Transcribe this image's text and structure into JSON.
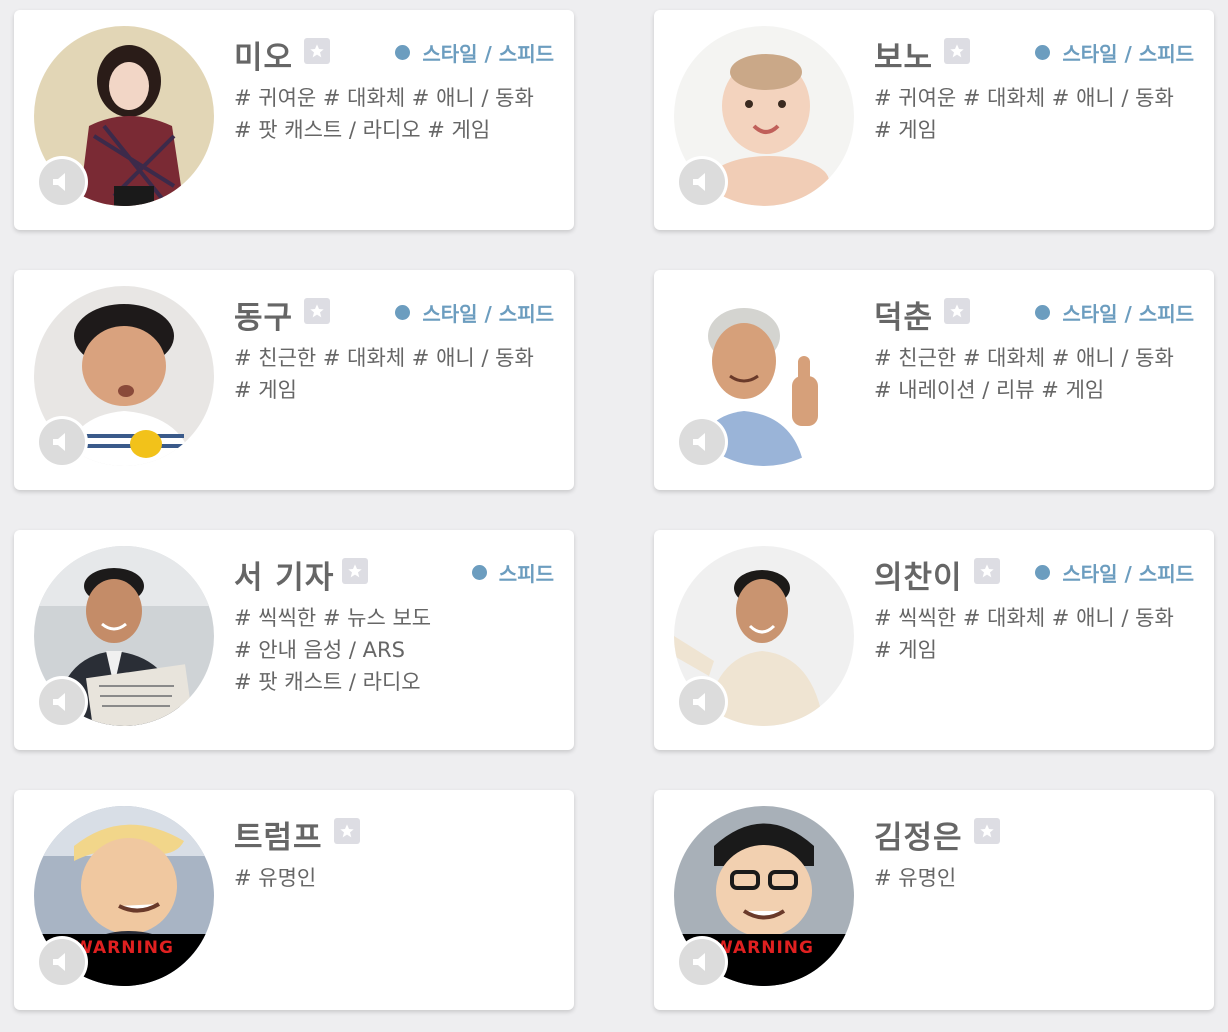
{
  "colors": {
    "accent": "#6c9dbf",
    "text": "#666666",
    "background": "#eeeef0",
    "warning": "#e02020"
  },
  "voices": [
    {
      "name": "미오",
      "options": "스타일 / 스피드",
      "tags": [
        "# 귀여운 # 대화체 # 애니 / 동화",
        "# 팟 캐스트 / 라디오 # 게임"
      ]
    },
    {
      "name": "보노",
      "options": "스타일 / 스피드",
      "tags": [
        "# 귀여운 # 대화체 # 애니 / 동화",
        "# 게임"
      ]
    },
    {
      "name": "동구",
      "options": "스타일 / 스피드",
      "tags": [
        "# 친근한 # 대화체 # 애니 / 동화",
        "# 게임"
      ]
    },
    {
      "name": "덕춘",
      "options": "스타일 / 스피드",
      "tags": [
        "# 친근한 # 대화체 # 애니 / 동화",
        "# 내레이션 / 리뷰 # 게임"
      ]
    },
    {
      "name": "서 기자",
      "options": "스피드",
      "tags": [
        "# 씩씩한 # 뉴스 보도",
        "# 안내 음성 / ARS",
        "# 팟 캐스트 / 라디오"
      ]
    },
    {
      "name": "의찬이",
      "options": "스타일 / 스피드",
      "tags": [
        "# 씩씩한 # 대화체 # 애니 / 동화",
        "# 게임"
      ]
    },
    {
      "name": "트럼프",
      "options": "",
      "warning": "WARNING",
      "tags": [
        "# 유명인"
      ]
    },
    {
      "name": "김정은",
      "options": "",
      "warning": "WARNING",
      "tags": [
        "# 유명인"
      ]
    }
  ]
}
